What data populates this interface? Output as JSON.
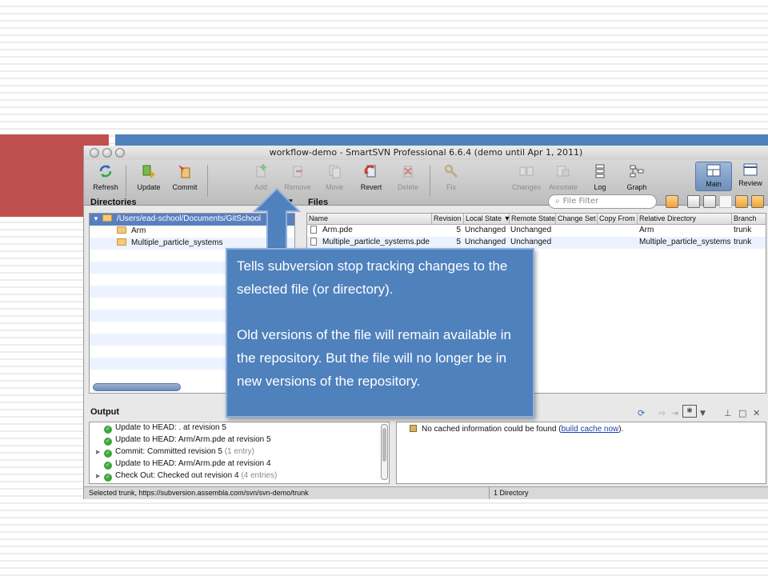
{
  "window": {
    "title": "workflow-demo - SmartSVN Professional 6.6.4 (demo until Apr 1, 2011)"
  },
  "toolbar": {
    "refresh": "Refresh",
    "update": "Update",
    "commit": "Commit",
    "add": "Add",
    "remove": "Remove",
    "move": "Move",
    "revert": "Revert",
    "delete": "Delete",
    "fix": "Fix",
    "changes": "Changes",
    "annotate": "Annotate",
    "log": "Log",
    "graph": "Graph",
    "main": "Main",
    "review": "Review"
  },
  "directories": {
    "header": "Directories",
    "root": "/Users/ead-school/Documents/GitSchool",
    "items": [
      "Arm",
      "Multiple_particle_systems"
    ]
  },
  "files": {
    "header": "Files",
    "filter_placeholder": "File Filter",
    "columns": [
      "Name",
      "Revision",
      "Local State ▼",
      "Remote State",
      "Change Set",
      "Copy From",
      "Relative Directory",
      "Branch"
    ],
    "rows": [
      {
        "name": "Arm.pde",
        "revision": "5",
        "local": "Unchanged",
        "remote": "Unchanged",
        "changeset": "",
        "copyfrom": "",
        "reldir": "Arm",
        "branch": "trunk"
      },
      {
        "name": "Multiple_particle_systems.pde",
        "revision": "5",
        "local": "Unchanged",
        "remote": "Unchanged",
        "changeset": "",
        "copyfrom": "",
        "reldir": "Multiple_particle_systems",
        "branch": "trunk"
      }
    ]
  },
  "output": {
    "header": "Output",
    "lines": [
      {
        "text": "Update to HEAD: . at revision 5",
        "extra": ""
      },
      {
        "text": "Update to HEAD: Arm/Arm.pde at revision 5",
        "extra": ""
      },
      {
        "text": "Commit: Committed revision 5",
        "extra": "(1 entry)"
      },
      {
        "text": "Update to HEAD: Arm/Arm.pde at revision 4",
        "extra": ""
      },
      {
        "text": "Check Out: Checked out revision 4",
        "extra": "(4 entries)"
      }
    ],
    "info_prefix": "No cached information could be found (",
    "info_link": "build cache now",
    "info_suffix": ")."
  },
  "status": {
    "left": "Selected trunk, https://subversion.assembla.com/svn/svn-demo/trunk",
    "right": "1 Directory"
  },
  "callout": {
    "para1": "Tells subversion stop tracking changes to the selected file (or directory).",
    "para2": "Old versions of the file will remain available in the repository. But the file will no longer be in new versions of the repository."
  },
  "colors": {
    "accent_red": "#c0504d",
    "accent_blue": "#4f81bd",
    "selection": "#5a7fbf"
  }
}
